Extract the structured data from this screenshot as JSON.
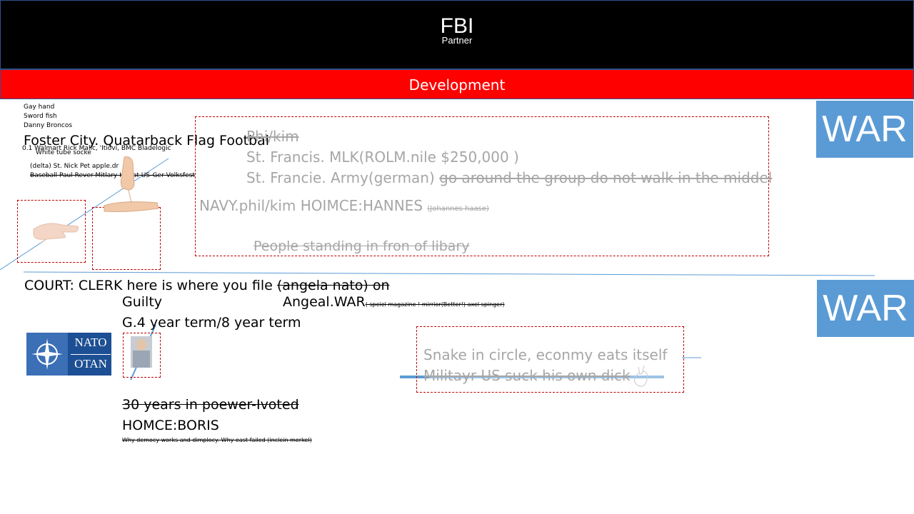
{
  "header": {
    "title": "FBI",
    "subtitle": "Partner"
  },
  "banner": {
    "label": "Development"
  },
  "war_buttons": [
    "WAR",
    "WAR"
  ],
  "notes_top": {
    "line1": "Gay hand",
    "line2": "Sword fish",
    "line3": "Danny Broncos",
    "foster": "Foster City. Quatarback Flag Footbal",
    "walmart": "0.1 Walmart Rick Malic, 'Itiovi, BMC Bladelogic",
    "tube": "White tube socke",
    "delta": "(delta) St. Nick Pet apple.dr",
    "baseball": "Baseball Paul Rever Mitlary Hat at US-Ger Volksfest"
  },
  "central_box": {
    "phi": "Phi/kim",
    "francis1": "St. Francis. MLK(ROLM.nile $250,000 )",
    "francis2_main": "St. Francie. Army(german) ",
    "francis2_strike": "go around the group do not walk in the middel",
    "navy": "NAVY.phil/kim HOIMCE:HANNES",
    "navy_small": "(Johannes haase)",
    "people": "People standing in fron of libary"
  },
  "court": {
    "main": "COURT: CLERK here is where you file ",
    "strike": "(angela nato) on",
    "guilty": "Guilty",
    "angeal": "Angeal.WAR",
    "angeal_small": "( speiel magazine ! mirrior(Better!) axel spinger)",
    "term": "G.4 year term/8 year term"
  },
  "nato": {
    "line1": "NATO",
    "line2": "OTAN"
  },
  "snake_box": {
    "line1": "Snake in circle, econmy eats itself",
    "line2": "Militayr US suck his own dick"
  },
  "bottom": {
    "years": "30 years in poewer-Ivoted",
    "boris": "HOMCE:BORIS",
    "democy": "Why democy works and dimplocy. Why east failed (inclein merkel)"
  },
  "colors": {
    "header_bg": "#000000",
    "banner_bg": "#ff0000",
    "war_bg": "#5b9bd5",
    "dash_border": "#c00000",
    "faded_text": "#a6a6a6"
  }
}
